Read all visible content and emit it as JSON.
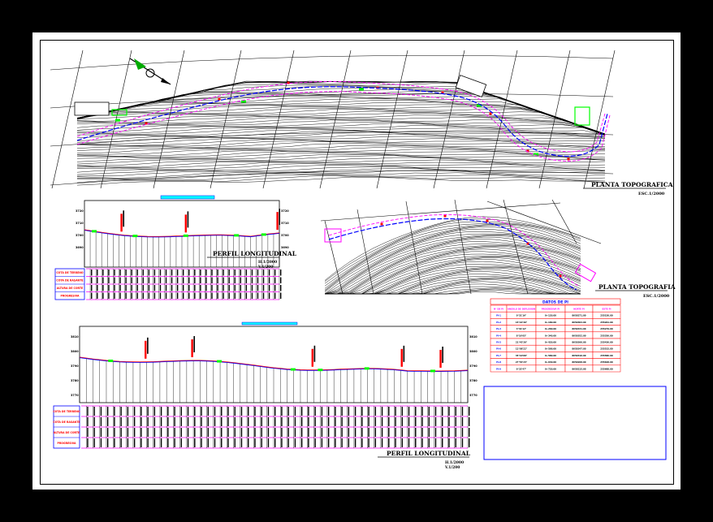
{
  "sheet": {
    "background": "#000000",
    "paper": "#ffffff"
  },
  "plan_top": {
    "title": "PLANTA TOPOGRAFICA",
    "scale": "ESC.1/2000"
  },
  "plan_right": {
    "title": "PLANTA TOPOGRAFIA",
    "scale": "ESC.1/2000"
  },
  "profile_small": {
    "title": "PERFIL LONGITUDINAL",
    "scale_h": "H.1/2000",
    "scale_v": "V.1/200",
    "row_labels": [
      "COTA DE TERRENO",
      "COTA DE RASANTE",
      "ALTURA DE CORTE",
      "PROGRESIVA"
    ],
    "elev_labels": [
      "3720",
      "3710",
      "3700",
      "3690"
    ]
  },
  "profile_big": {
    "title": "PERFIL LONGITUDINAL",
    "scale_h": "H.1/2000",
    "scale_v": "V.1/200",
    "row_labels": [
      "COTA DE TERRENO",
      "COTA DE RASANTE",
      "ALTURA DE CORTE",
      "PROGRESIVA"
    ],
    "elev_labels": [
      "3810",
      "3800",
      "3790",
      "3780",
      "3770"
    ]
  },
  "curve_table": {
    "title": "DATOS DE PI",
    "headers": [
      "N° DE PI",
      "ANGULO DE DEFLEXION",
      "PROGRESIVA PI",
      "NORTE PI",
      "ESTE PI"
    ],
    "rows": [
      [
        "PI-1",
        "0°31'16\"",
        "0+120.00",
        "8650271.00",
        "255150.00"
      ],
      [
        "PI-2",
        "15°22'40\"",
        "0+180.00",
        "8650304.00",
        "255201.00"
      ],
      [
        "PI-3",
        "3°41'12\"",
        "0+260.00",
        "8650331.00",
        "255279.00"
      ],
      [
        "PI-4",
        "8°16'05\"",
        "0+340.00",
        "8650352.00",
        "255356.00"
      ],
      [
        "PI-5",
        "21°45'30\"",
        "0+420.00",
        "8650360.00",
        "255436.00"
      ],
      [
        "PI-6",
        "12°08'22\"",
        "0+500.00",
        "8650347.00",
        "255515.00"
      ],
      [
        "PI-7",
        "35°10'08\"",
        "0+580.00",
        "8650310.00",
        "255586.00"
      ],
      [
        "PI-8",
        "27°54'15\"",
        "0+640.00",
        "8650268.00",
        "255628.00"
      ],
      [
        "PI-9",
        "9°33'47\"",
        "0+720.00",
        "8650215.00",
        "255688.00"
      ]
    ]
  },
  "colors": {
    "contour": "#000000",
    "axis_road": "#0000ff",
    "road_edge": "#ff00ff",
    "ground_line": "#ff0000",
    "marker_green": "#00ff00",
    "table_header": "#0000ff",
    "label_red": "#ff0000"
  }
}
